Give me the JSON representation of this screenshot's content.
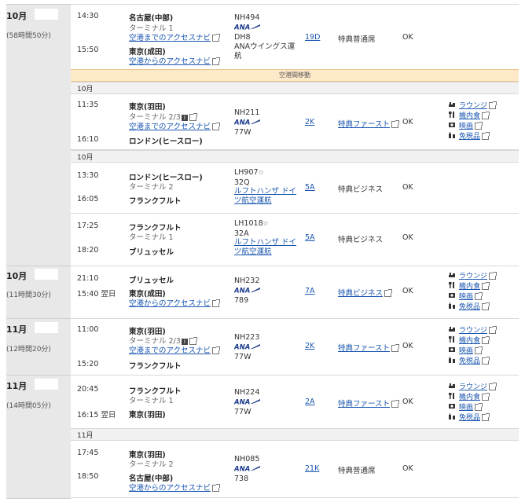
{
  "transfer_label": "空港間移動",
  "ok": "OK",
  "services": {
    "lounge": "ラウンジ",
    "meal": "機内食",
    "movie": "映画",
    "dutyfree": "免税品"
  },
  "groups": [
    {
      "date": "10月",
      "duration": "(58時間50分)"
    },
    {
      "date": "10月",
      "duration": "(11時間30分)"
    },
    {
      "date": "11月",
      "duration": "(12時間20分)"
    },
    {
      "date": "11月",
      "duration": "(14時間05分)"
    }
  ],
  "day_bars": [
    "10月",
    "10月",
    "11月"
  ],
  "segments": [
    {
      "dep_time": "14:30",
      "dep_city": "名古屋(中部)",
      "dep_terminal": "ターミナル 1",
      "dep_link": "空港までのアクセスナビ",
      "arr_time": "15:50",
      "arr_city": "東京(成田)",
      "arr_link": "空港からのアクセスナビ",
      "flight": "NH494",
      "equip": "DH8",
      "operator": "ANAウイングス運航",
      "seat": "19D",
      "cls": "特典普通席",
      "status": "OK"
    },
    {
      "dep_time": "11:35",
      "dep_city": "東京(羽田)",
      "dep_terminal": "ターミナル 2/3",
      "dep_link": "空港までのアクセスナビ",
      "arr_time": "16:10",
      "arr_city": "ロンドン(ヒースロー)",
      "flight": "NH211",
      "equip": "77W",
      "seat": "2K",
      "cls": "特典ファースト",
      "status": "OK"
    },
    {
      "dep_time": "13:30",
      "dep_city": "ロンドン(ヒースロー)",
      "dep_terminal": "ターミナル 2",
      "arr_time": "16:05",
      "arr_city": "フランクフルト",
      "flight": "LH907",
      "equip": "32Q",
      "operator": "ルフトハンザ ドイツ航空運航",
      "seat": "5A",
      "cls": "特典ビジネス",
      "status": "OK"
    },
    {
      "dep_time": "17:25",
      "dep_city": "フランクフルト",
      "dep_terminal": "ターミナル 1",
      "arr_time": "18:20",
      "arr_city": "ブリュッセル",
      "flight": "LH1018",
      "equip": "32A",
      "operator": "ルフトハンザ ドイツ航空運航",
      "seat": "5A",
      "cls": "特典ビジネス",
      "status": "OK"
    },
    {
      "dep_time": "21:10",
      "dep_city": "ブリュッセル",
      "arr_time": "15:40 翌日",
      "arr_city": "東京(成田)",
      "arr_link": "空港からのアクセスナビ",
      "flight": "NH232",
      "equip": "789",
      "seat": "7A",
      "cls": "特典ビジネス",
      "status": "OK"
    },
    {
      "dep_time": "11:00",
      "dep_city": "東京(羽田)",
      "dep_terminal": "ターミナル 2/3",
      "dep_link": "空港までのアクセスナビ",
      "arr_time": "15:20",
      "arr_city": "フランクフルト",
      "flight": "NH223",
      "equip": "77W",
      "seat": "2K",
      "cls": "特典ファースト",
      "status": "OK"
    },
    {
      "dep_time": "20:45",
      "dep_city": "フランクフルト",
      "dep_terminal": "ターミナル 1",
      "arr_time": "16:15 翌日",
      "arr_city": "東京(羽田)",
      "flight": "NH224",
      "equip": "77W",
      "seat": "2A",
      "cls": "特典ファースト",
      "status": "OK"
    },
    {
      "dep_time": "17:45",
      "dep_city": "東京(羽田)",
      "dep_terminal": "ターミナル 2",
      "arr_time": "18:50",
      "arr_city": "名古屋(中部)",
      "arr_link": "空港からのアクセスナビ",
      "flight": "NH085",
      "equip": "738",
      "seat": "21K",
      "cls": "特典普通席",
      "status": "OK"
    }
  ]
}
